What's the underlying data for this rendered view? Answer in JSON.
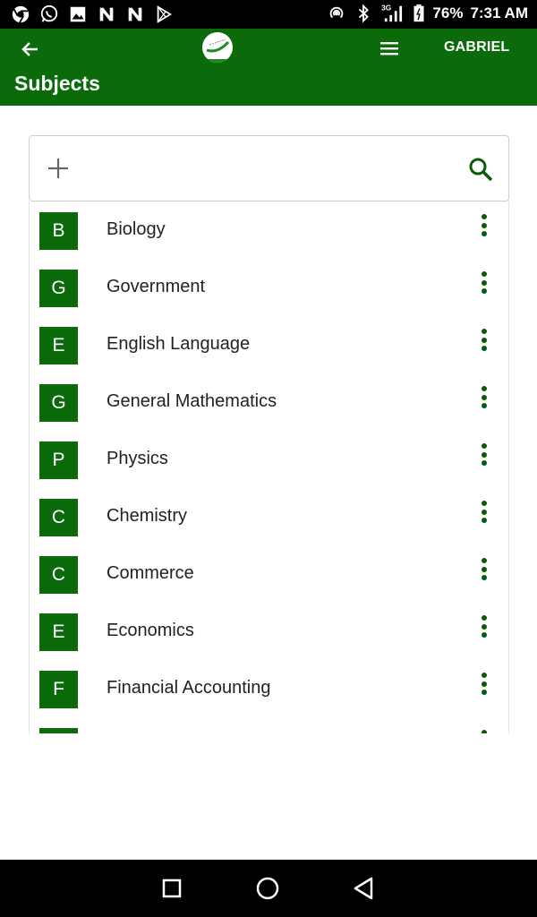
{
  "status_bar": {
    "battery": "76%",
    "time": "7:31 AM",
    "network": "3G",
    "left_icons": [
      "chrome-icon",
      "whatsapp-icon",
      "gallery-icon",
      "n-app-icon",
      "n-app-icon",
      "play-store-icon"
    ],
    "right_icons": [
      "hotspot-icon",
      "bluetooth-icon",
      "signal-icon",
      "battery-icon"
    ]
  },
  "app_bar": {
    "user": "GABRIEL",
    "title": "Subjects",
    "color": "#0b6b0b"
  },
  "search": {
    "placeholder": "",
    "value": ""
  },
  "subjects": [
    {
      "initial": "B",
      "name": "Biology"
    },
    {
      "initial": "G",
      "name": "Government"
    },
    {
      "initial": "E",
      "name": "English Language"
    },
    {
      "initial": "G",
      "name": "General Mathematics"
    },
    {
      "initial": "P",
      "name": "Physics"
    },
    {
      "initial": "C",
      "name": "Chemistry"
    },
    {
      "initial": "C",
      "name": "Commerce"
    },
    {
      "initial": "E",
      "name": "Economics"
    },
    {
      "initial": "F",
      "name": "Financial Accounting"
    }
  ],
  "nav": [
    "recents-icon",
    "home-icon",
    "back-icon"
  ]
}
